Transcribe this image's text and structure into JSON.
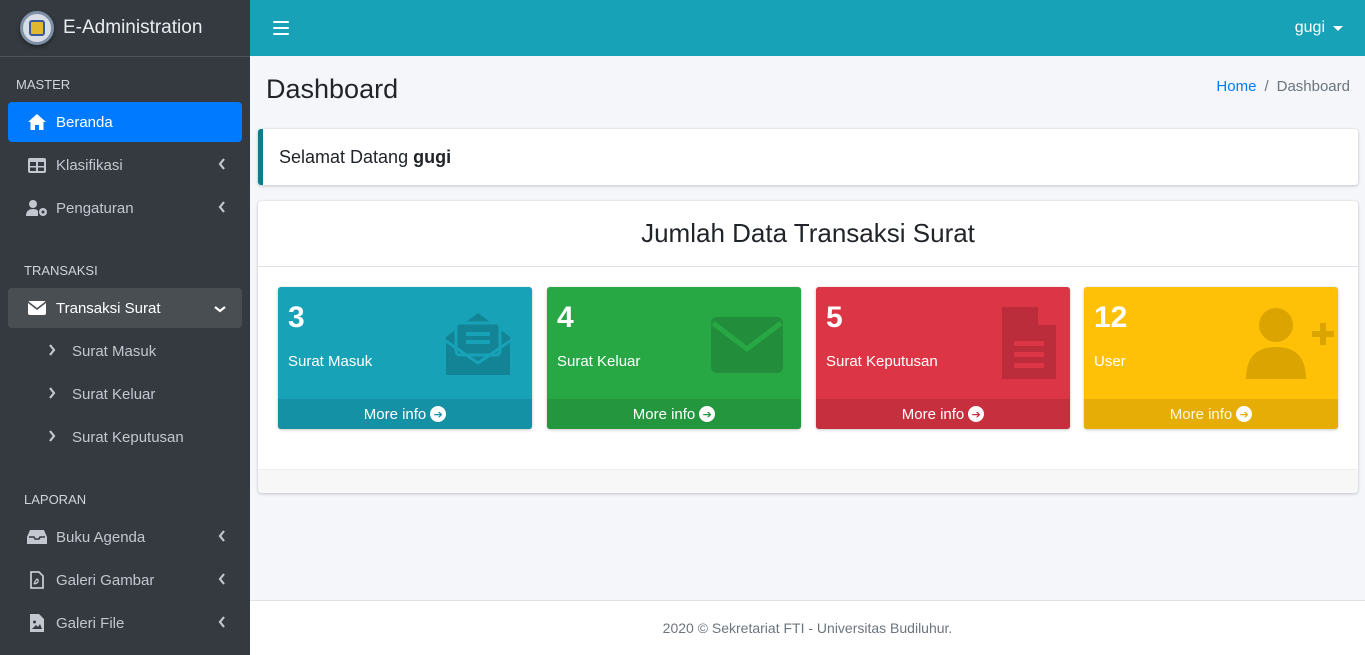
{
  "brand": {
    "title": "E-Administration"
  },
  "sidebar": {
    "sections": [
      {
        "header": "MASTER"
      },
      {
        "header": "TRANSAKSI"
      },
      {
        "header": "LAPORAN"
      }
    ],
    "items": [
      {
        "label": "Beranda",
        "icon": "home-icon"
      },
      {
        "label": "Klasifikasi",
        "icon": "table-icon"
      },
      {
        "label": "Pengaturan",
        "icon": "users-cog-icon"
      },
      {
        "label": "Transaksi Surat",
        "icon": "envelope-icon"
      },
      {
        "label": "Surat Masuk"
      },
      {
        "label": "Surat Keluar"
      },
      {
        "label": "Surat Keputusan"
      },
      {
        "label": "Buku Agenda",
        "icon": "inbox-icon"
      },
      {
        "label": "Galeri Gambar",
        "icon": "file-pdf-icon"
      },
      {
        "label": "Galeri File",
        "icon": "file-image-icon"
      }
    ]
  },
  "topbar": {
    "user": "gugi"
  },
  "page": {
    "title": "Dashboard",
    "breadcrumb": {
      "home": "Home",
      "separator": "/",
      "current": "Dashboard"
    }
  },
  "welcome": {
    "text": "Selamat Datang",
    "user": "gugi"
  },
  "card": {
    "title": "Jumlah Data Transaksi Surat"
  },
  "stats": [
    {
      "value": "3",
      "label": "Surat Masuk",
      "more": "More info",
      "color": "#17a2b8"
    },
    {
      "value": "4",
      "label": "Surat Keluar",
      "more": "More info",
      "color": "#28a745"
    },
    {
      "value": "5",
      "label": "Surat Keputusan",
      "more": "More info",
      "color": "#dc3545"
    },
    {
      "value": "12",
      "label": "User",
      "more": "More info",
      "color": "#ffc107"
    }
  ],
  "footer": {
    "text": "2020 © Sekretariat FTI - Universitas Budiluhur."
  }
}
